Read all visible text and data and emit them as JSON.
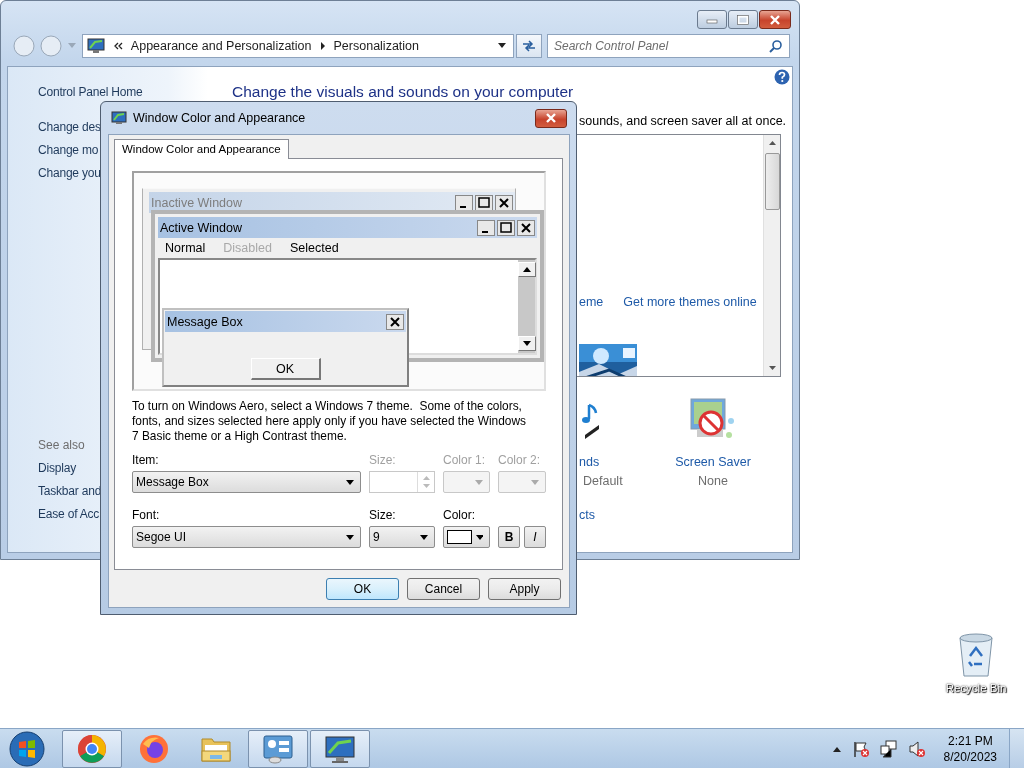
{
  "control_panel": {
    "address": {
      "crumbs": [
        "Appearance and Personalization",
        "Personalization"
      ]
    },
    "search": {
      "placeholder": "Search Control Panel"
    },
    "sidebar": {
      "home": "Control Panel Home",
      "tasks": [
        "Change des",
        "Change mo",
        "Change you"
      ],
      "see_also_title": "See also",
      "see_also": [
        "Display",
        "Taskbar and",
        "Ease of Acc"
      ]
    },
    "heading": "Change the visuals and sounds on your computer",
    "intro": "sounds, and screen saver all at once.",
    "theme_links": [
      "eme",
      "Get more themes online"
    ],
    "settings": [
      {
        "kind": "sounds",
        "label": "nds",
        "value": "Default"
      },
      {
        "kind": "screen_saver",
        "label": "Screen Saver",
        "value": "None"
      }
    ],
    "more_link": "cts"
  },
  "dialog": {
    "title": "Window Color and Appearance",
    "tabs": [
      {
        "label": "Window Color and Appearance",
        "selected": true
      }
    ],
    "preview": {
      "inactive_title": "Inactive Window",
      "active_title": "Active Window",
      "menu": [
        {
          "label": "Normal",
          "kind": "normal"
        },
        {
          "label": "Disabled",
          "kind": "disabled"
        },
        {
          "label": "Selected",
          "kind": "selected"
        }
      ],
      "message_title": "Message Box",
      "message_button": "OK"
    },
    "note": "To turn on Windows Aero, select a Windows 7 theme.  Some of the colors, fonts, and sizes selected here apply only if you have selected the Windows 7 Basic theme or a High Contrast theme.",
    "item": {
      "label": "Item:",
      "value": "Message Box"
    },
    "item_size": {
      "label": "Size:",
      "disabled": true
    },
    "color1": {
      "label": "Color 1:",
      "disabled": true
    },
    "color2": {
      "label": "Color 2:",
      "disabled": true
    },
    "font": {
      "label": "Font:",
      "value": "Segoe UI"
    },
    "font_size": {
      "label": "Size:",
      "value": "9"
    },
    "font_color": {
      "label": "Color:",
      "color": "#ffffff"
    },
    "bold": {
      "label": "B",
      "on": false
    },
    "italic": {
      "label": "I",
      "on": false
    },
    "buttons": [
      {
        "label": "OK",
        "default": true
      },
      {
        "label": "Cancel",
        "default": false
      },
      {
        "label": "Apply",
        "default": false
      }
    ]
  },
  "desktop_icons": [
    {
      "label": "Recycle Bin"
    }
  ],
  "taskbar": {
    "apps": [
      {
        "kind": "chrome",
        "running": true
      },
      {
        "kind": "firefox",
        "running": false
      },
      {
        "kind": "explorer",
        "running": false
      },
      {
        "kind": "control_panel",
        "running": true
      },
      {
        "kind": "personalization",
        "running": true
      }
    ],
    "clock": {
      "time": "2:21 PM",
      "date": "8/20/2023"
    }
  }
}
